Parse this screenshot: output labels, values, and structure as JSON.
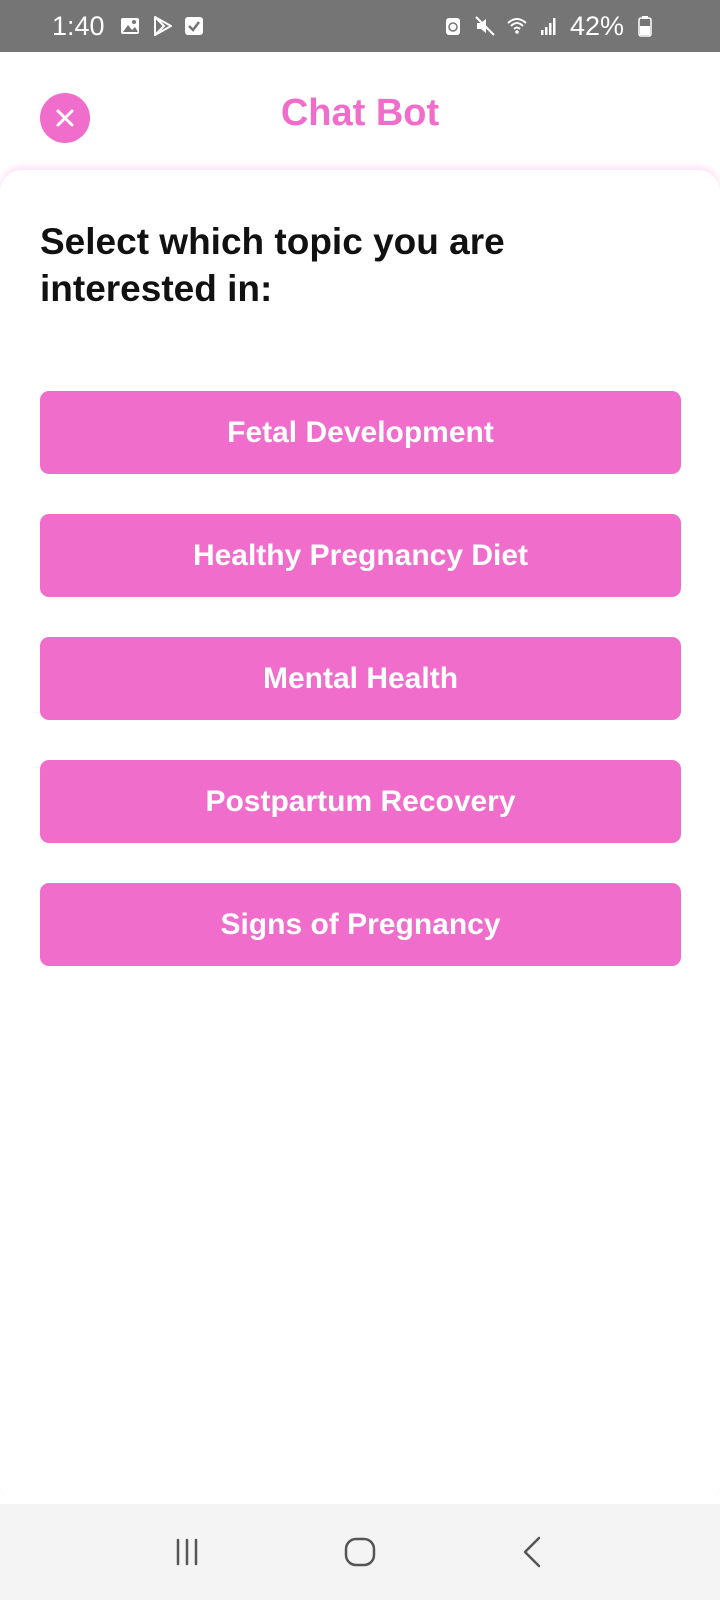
{
  "status_bar": {
    "time": "1:40",
    "battery_text": "42%",
    "left_icons": [
      "gallery-icon",
      "play-store-icon",
      "checkbox-icon"
    ],
    "right_icons": [
      "recycle-icon",
      "mute-icon",
      "wifi-icon",
      "signal-icon",
      "battery-icon"
    ]
  },
  "header": {
    "title": "Chat Bot",
    "close_icon": "close-icon"
  },
  "main": {
    "prompt": "Select which topic you are interested in:",
    "topics": [
      {
        "label": "Fetal Development"
      },
      {
        "label": "Healthy Pregnancy Diet"
      },
      {
        "label": "Mental Health"
      },
      {
        "label": "Postpartum Recovery"
      },
      {
        "label": "Signs of Pregnancy"
      }
    ]
  },
  "nav_bar": {
    "buttons": [
      "recent-apps-icon",
      "home-icon",
      "back-icon"
    ]
  },
  "colors": {
    "accent": "#f06dcc",
    "status_bar_bg": "#757575",
    "nav_bar_bg": "#f4f4f4",
    "text": "#111111"
  }
}
